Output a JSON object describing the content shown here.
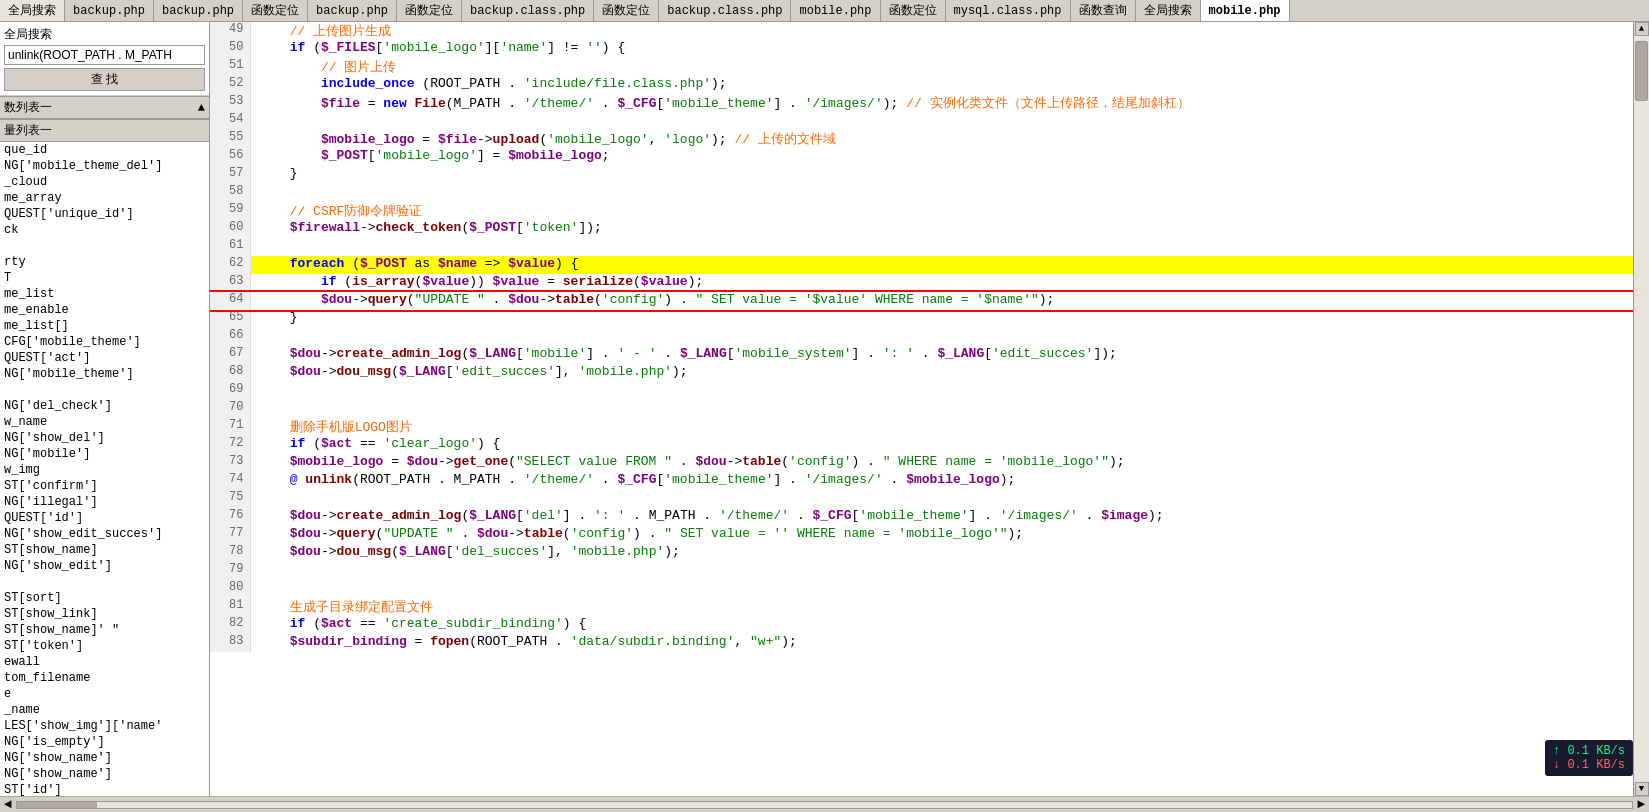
{
  "tabs": [
    {
      "label": "全局搜索",
      "active": false
    },
    {
      "label": "backup.php",
      "active": false
    },
    {
      "label": "backup.php",
      "active": false
    },
    {
      "label": "函数定位",
      "active": false
    },
    {
      "label": "backup.php",
      "active": false
    },
    {
      "label": "函数定位",
      "active": false
    },
    {
      "label": "backup.class.php",
      "active": false
    },
    {
      "label": "函数定位",
      "active": false
    },
    {
      "label": "backup.class.php",
      "active": false
    },
    {
      "label": "mobile.php",
      "active": false
    },
    {
      "label": "函数定位",
      "active": false
    },
    {
      "label": "mysql.class.php",
      "active": false
    },
    {
      "label": "函数查询",
      "active": false
    },
    {
      "label": "全局搜索",
      "active": false
    },
    {
      "label": "mobile.php",
      "active": true
    }
  ],
  "sidebar": {
    "search_label": "全局搜索",
    "search_value": "unlink(ROOT_PATH . M_PATH",
    "search_placeholder": "",
    "find_button": "查 找",
    "list1_header": "数列表一",
    "list2_header": "量列表一",
    "list_items": [
      "que_id",
      "NG['mobile_theme_del']",
      "_cloud",
      "me_array",
      "QUEST['unique_id']",
      "ck",
      "",
      "rty",
      "T",
      "me_list",
      "me_enable",
      "me_list[]",
      "CFG['mobile_theme']",
      "QUEST['act']",
      "NG['mobile_theme']",
      "",
      "NG['del_check']",
      "w_name",
      "NG['show_del']",
      "NG['mobile']",
      "w_img",
      "ST['confirm']",
      "NG['illegal']",
      "QUEST['id']",
      "NG['show_edit_succes']",
      "ST[show_name]",
      "NG['show_edit']",
      "",
      "ST[sort]",
      "ST[show_link]",
      "ST[show_name]' \"",
      "ST['token']",
      "ewall",
      "tom_filename",
      "e",
      "_name",
      "LES['show_img']['name'",
      "NG['is_empty']",
      "NG['show_name']",
      "NG['show_name']",
      "ST['id']"
    ]
  },
  "code_lines": [
    {
      "num": 49,
      "content": "    // 上传图片生成",
      "type": "comment"
    },
    {
      "num": 50,
      "content": "    if ($_FILES['mobile_logo']['name'] != '') {",
      "type": "code"
    },
    {
      "num": 51,
      "content": "        // 图片上传",
      "type": "comment"
    },
    {
      "num": 52,
      "content": "        include_once (ROOT_PATH . 'include/file.class.php');",
      "type": "code"
    },
    {
      "num": 53,
      "content": "        $file = new File(M_PATH . '/theme/' . $_CFG['mobile_theme'] . '/images/'); // 实例化类文件（文件上传路径，结尾加斜杠）",
      "type": "code"
    },
    {
      "num": 54,
      "content": "",
      "type": "empty"
    },
    {
      "num": 55,
      "content": "        $mobile_logo = $file->upload('mobile_logo', 'logo'); // 上传的文件域",
      "type": "code"
    },
    {
      "num": 56,
      "content": "        $_POST['mobile_logo'] = $mobile_logo;",
      "type": "code"
    },
    {
      "num": 57,
      "content": "    }",
      "type": "code"
    },
    {
      "num": 58,
      "content": "",
      "type": "empty"
    },
    {
      "num": 59,
      "content": "    // CSRF防御令牌验证",
      "type": "comment"
    },
    {
      "num": 60,
      "content": "    $firewall->check_token($_POST['token']);",
      "type": "code"
    },
    {
      "num": 61,
      "content": "",
      "type": "empty"
    },
    {
      "num": 62,
      "content": "    foreach ($_POST as $name => $value) {",
      "type": "code",
      "highlight": true
    },
    {
      "num": 63,
      "content": "        if (is_array($value)) $value = serialize($value);",
      "type": "code"
    },
    {
      "num": 64,
      "content": "        $dou->query(\"UPDATE \" . $dou->table('config') . \" SET value = '$value' WHERE name = '$name'\");",
      "type": "code",
      "boxed": true
    },
    {
      "num": 65,
      "content": "    }",
      "type": "code"
    },
    {
      "num": 66,
      "content": "",
      "type": "empty"
    },
    {
      "num": 67,
      "content": "    $dou->create_admin_log($_LANG['mobile'] . ' - ' . $_LANG['mobile_system'] . ': ' . $_LANG['edit_succes']);",
      "type": "code"
    },
    {
      "num": 68,
      "content": "    $dou->dou_msg($_LANG['edit_succes'], 'mobile.php');",
      "type": "code"
    },
    {
      "num": 69,
      "content": "",
      "type": "empty"
    },
    {
      "num": 70,
      "content": "",
      "type": "empty"
    },
    {
      "num": 71,
      "content": "    删除手机版LOGO图片",
      "type": "comment_cn"
    },
    {
      "num": 72,
      "content": "    if ($act == 'clear_logo') {",
      "type": "code"
    },
    {
      "num": 73,
      "content": "    $mobile_logo = $dou->get_one(\"SELECT value FROM \" . $dou->table('config') . \" WHERE name = 'mobile_logo'\");",
      "type": "code"
    },
    {
      "num": 74,
      "content": "    @ unlink(ROOT_PATH . M_PATH . '/theme/' . $_CFG['mobile_theme'] . '/images/' . $mobile_logo);",
      "type": "code"
    },
    {
      "num": 75,
      "content": "",
      "type": "empty"
    },
    {
      "num": 76,
      "content": "    $dou->create_admin_log($_LANG['del'] . ': ' . M_PATH . '/theme/' . $_CFG['mobile_theme'] . '/images/' . $image);",
      "type": "code"
    },
    {
      "num": 77,
      "content": "    $dou->query(\"UPDATE \" . $dou->table('config') . \" SET value = '' WHERE name = 'mobile_logo'\");",
      "type": "code"
    },
    {
      "num": 78,
      "content": "    $dou->dou_msg($_LANG['del_succes'], 'mobile.php');",
      "type": "code"
    },
    {
      "num": 79,
      "content": "",
      "type": "empty"
    },
    {
      "num": 80,
      "content": "",
      "type": "empty"
    },
    {
      "num": 81,
      "content": "    生成子目录绑定配置文件",
      "type": "comment_cn"
    },
    {
      "num": 82,
      "content": "    if ($act == 'create_subdir_binding') {",
      "type": "code"
    },
    {
      "num": 83,
      "content": "    $subdir_binding = fopen(ROOT_PATH . 'data/subdir.binding', \"w+\");",
      "type": "code"
    }
  ],
  "speed": {
    "up_label": "↑ 0.1 KB/s",
    "down_label": "↓ 0.1 KB/s"
  }
}
